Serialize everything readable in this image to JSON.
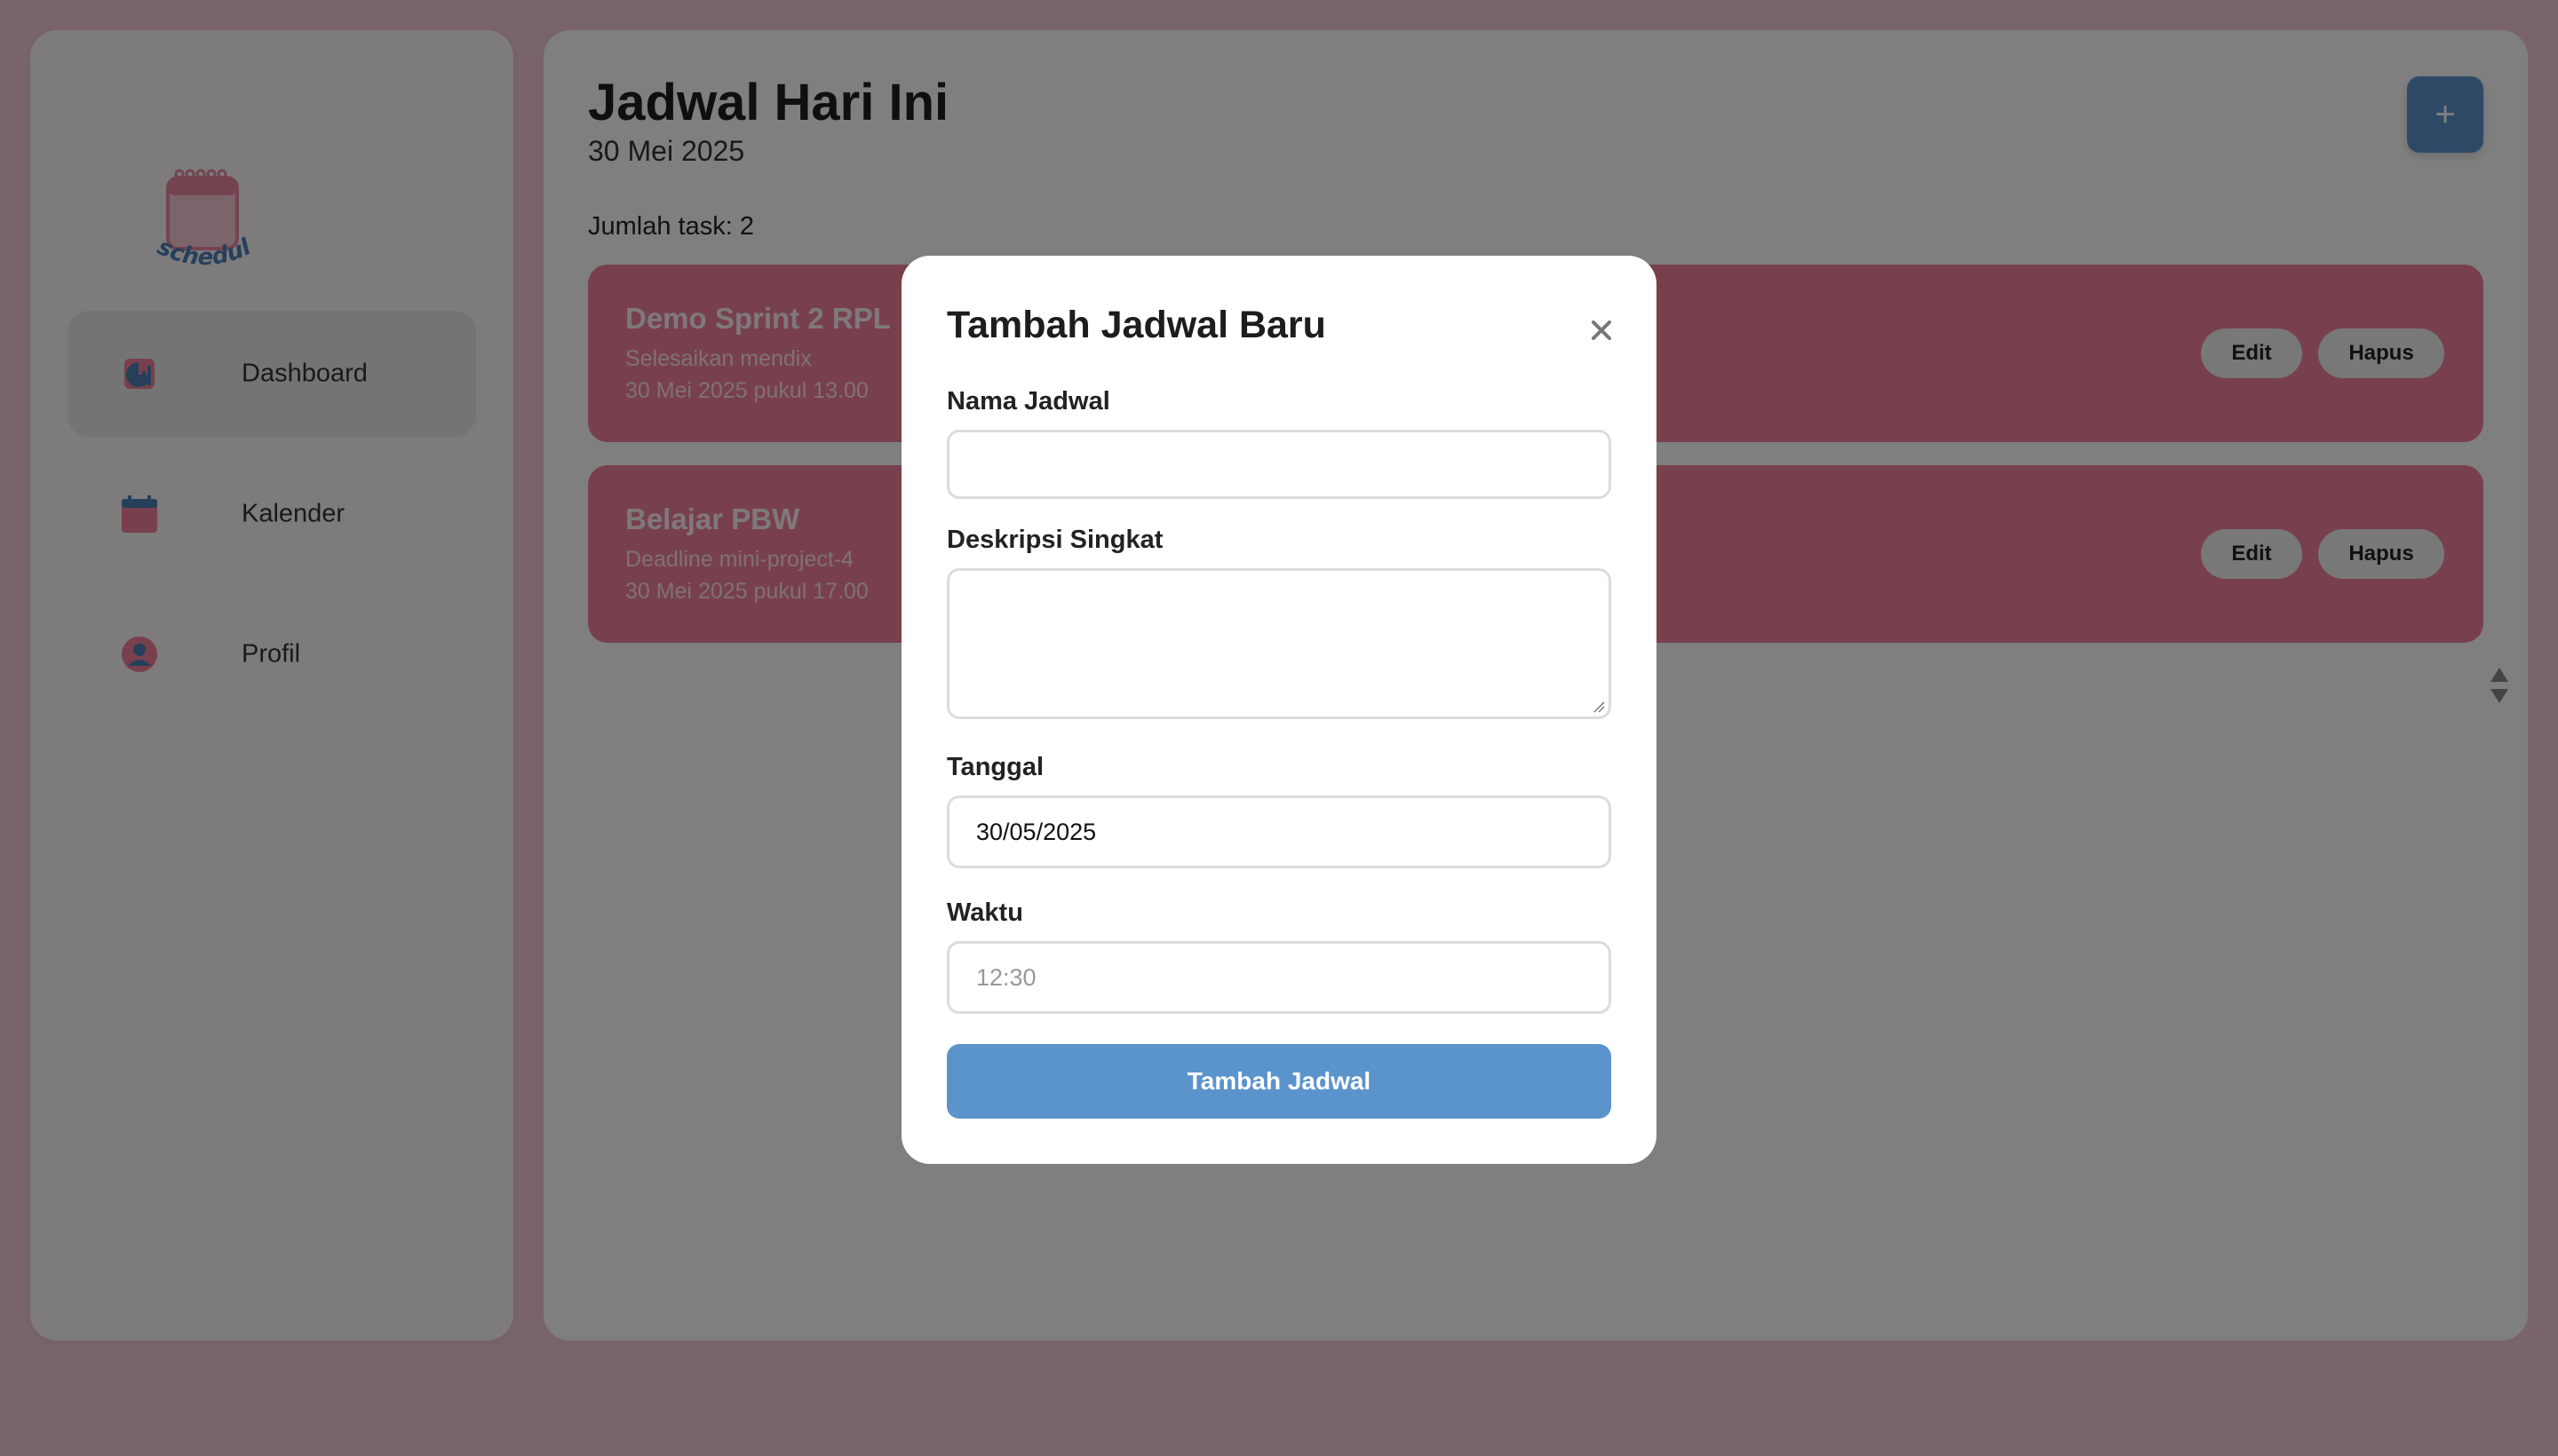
{
  "sidebar": {
    "logo_text": "schedula",
    "items": [
      {
        "label": "Dashboard",
        "icon": "dashboard-pie-icon"
      },
      {
        "label": "Kalender",
        "icon": "calendar-icon"
      },
      {
        "label": "Profil",
        "icon": "user-icon"
      }
    ]
  },
  "main": {
    "title": "Jadwal Hari Ini",
    "date": "30 Mei 2025",
    "task_count": "Jumlah task: 2",
    "add_button": "+",
    "tasks": [
      {
        "title": "Demo Sprint 2 RPL",
        "description": "Selesaikan mendix",
        "time": "30 Mei 2025 pukul 13.00",
        "edit": "Edit",
        "delete": "Hapus"
      },
      {
        "title": "Belajar PBW",
        "description": "Deadline mini-project-4",
        "time": "30 Mei 2025 pukul 17.00",
        "edit": "Edit",
        "delete": "Hapus"
      }
    ]
  },
  "modal": {
    "title": "Tambah Jadwal Baru",
    "close": "×",
    "fields": {
      "nama": {
        "label": "Nama Jadwal",
        "value": ""
      },
      "deskripsi": {
        "label": "Deskripsi Singkat",
        "value": ""
      },
      "tanggal": {
        "label": "Tanggal",
        "value": "30/05/2025"
      },
      "waktu": {
        "label": "Waktu",
        "placeholder": "12:30"
      }
    },
    "submit": "Tambah Jadwal"
  },
  "colors": {
    "background": "#f1c8d4",
    "card": "#f1809b",
    "accent": "#5b93cc"
  }
}
